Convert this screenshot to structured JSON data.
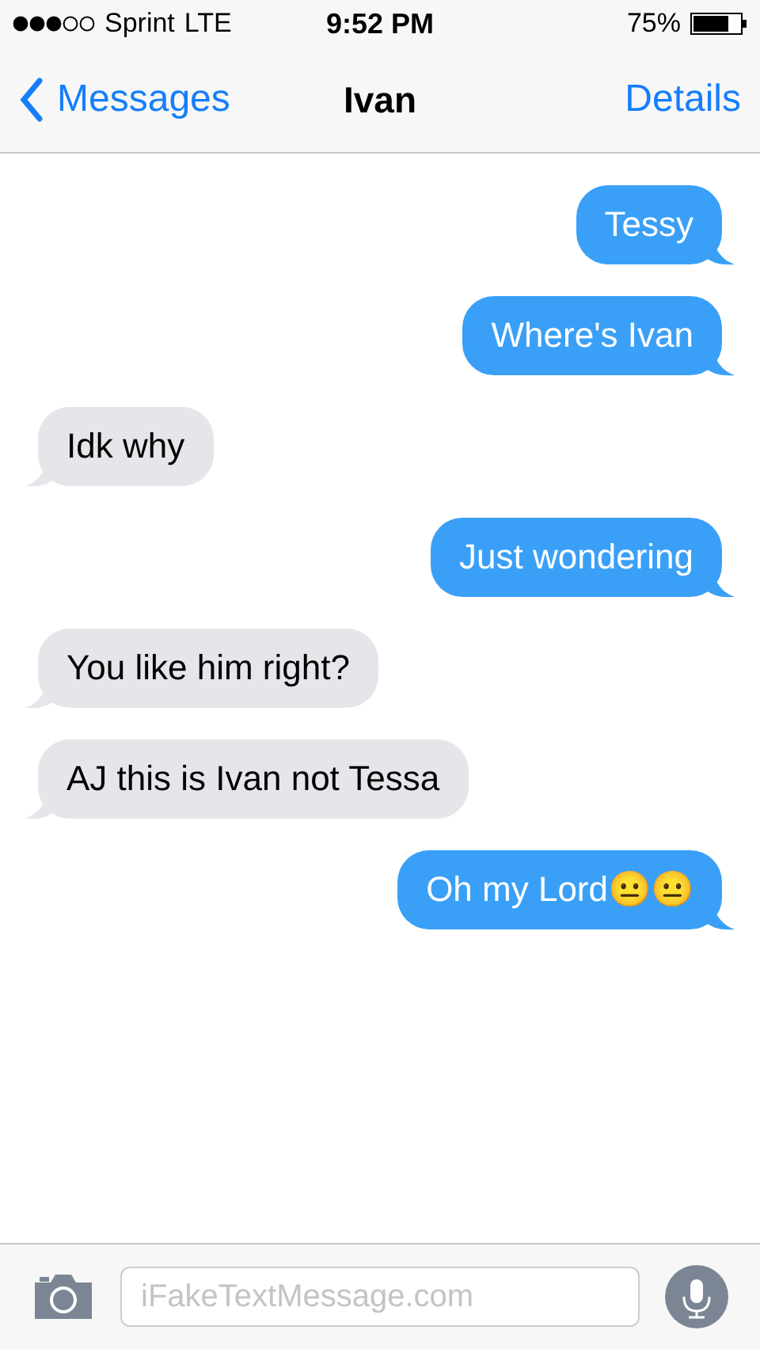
{
  "status_bar": {
    "carrier": "Sprint",
    "network": "LTE",
    "time": "9:52 PM",
    "battery": "75%"
  },
  "nav": {
    "back": "Messages",
    "title": "Ivan",
    "action": "Details"
  },
  "messages": [
    {
      "kind": "sent",
      "text": "Tessy"
    },
    {
      "kind": "sent",
      "text": "Where's Ivan"
    },
    {
      "kind": "received",
      "text": "Idk why"
    },
    {
      "kind": "sent",
      "text": "Just wondering"
    },
    {
      "kind": "received",
      "text": "You like him right?"
    },
    {
      "kind": "received",
      "text": "AJ this is Ivan not Tessa"
    },
    {
      "kind": "sent",
      "text": "Oh my Lord😐😐"
    }
  ],
  "composer": {
    "placeholder": "iFakeTextMessage.com"
  }
}
